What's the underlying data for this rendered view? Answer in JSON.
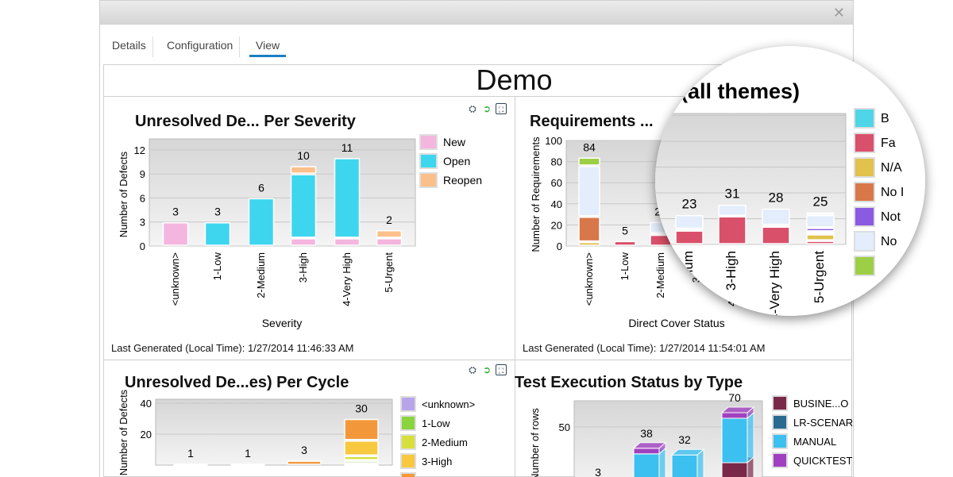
{
  "window": {
    "close_icon": "close-icon",
    "tabs": [
      "Details",
      "Configuration",
      "View"
    ],
    "active_tab": "View"
  },
  "dashboard_title": "Demo",
  "panel_icons": [
    "settings-icon",
    "refresh-icon",
    "maximize-icon"
  ],
  "chart_data": [
    {
      "type": "bar",
      "stacked": true,
      "title": "Unresolved De... Per Severity",
      "xlabel": "Severity",
      "ylabel": "Number of Defects",
      "categories": [
        "<unknown>",
        "1-Low",
        "2-Medium",
        "3-High",
        "4-Very High",
        "5-Urgent"
      ],
      "series": [
        {
          "name": "New",
          "color": "#f4b6df",
          "values": [
            3,
            0,
            0,
            1,
            1,
            1
          ]
        },
        {
          "name": "Open",
          "color": "#3ed6ef",
          "values": [
            0,
            3,
            6,
            8,
            10,
            0
          ]
        },
        {
          "name": "Reopen",
          "color": "#fbc08a",
          "values": [
            0,
            0,
            0,
            1,
            0,
            1
          ]
        }
      ],
      "totals": [
        "3",
        "3",
        "6",
        "10",
        "11",
        "2"
      ],
      "yticks": [
        "0",
        "3",
        "6",
        "9",
        "12"
      ],
      "ylim": [
        0,
        13.4
      ],
      "grid": true,
      "legend": "right",
      "footer": "Last Generated (Local Time):  1/27/2014 11:46:33 AM"
    },
    {
      "type": "bar",
      "stacked": true,
      "title": "Requirements ...",
      "magnified_title": ". (all themes)",
      "xlabel": "Direct Cover Status",
      "ylabel": "Number of Requirements",
      "categories": [
        "<unknown>",
        "1-Low",
        "2-Medium",
        "3-High",
        "4-Very High",
        "5-Urgent"
      ],
      "series": [
        {
          "name": "B",
          "color": "#4fd5e8",
          "values": [
            0,
            0,
            0,
            0,
            0,
            0
          ]
        },
        {
          "name": "Fa",
          "color": "#d9506b",
          "values": [
            0,
            5,
            11,
            22,
            14,
            3
          ]
        },
        {
          "name": "N/A",
          "color": "#e0c24c",
          "values": [
            4,
            0,
            0,
            0,
            0,
            5
          ]
        },
        {
          "name": "No I",
          "color": "#d8784a",
          "values": [
            24,
            0,
            1,
            0,
            1,
            2
          ]
        },
        {
          "name": "Not",
          "color": "#8a5ae0",
          "values": [
            0,
            0,
            0,
            0,
            0,
            3
          ]
        },
        {
          "name": "No",
          "color": "#e3edfb",
          "values": [
            48,
            0,
            11,
            9,
            13,
            10
          ]
        },
        {
          "name": "",
          "color": "#9ccf45",
          "values": [
            8,
            0,
            0,
            0,
            0,
            2
          ]
        }
      ],
      "totals": [
        "84",
        "5",
        "23",
        "31",
        "28",
        "25"
      ],
      "yticks": [
        "0",
        "20",
        "40",
        "60",
        "80",
        "100"
      ],
      "ylim": [
        0,
        100
      ],
      "grid": true,
      "legend": "right",
      "footer": "Last Generated (Local Time):  1/27/2014 11:54:01 AM"
    },
    {
      "type": "bar",
      "stacked": true,
      "title": "Unresolved De...es) Per Cycle",
      "ylabel": "Number of Defects",
      "series": [
        {
          "name": "<unknown>",
          "color": "#b8a4ea",
          "values": [
            0,
            0,
            0,
            1
          ]
        },
        {
          "name": "1-Low",
          "color": "#8ad43c",
          "values": [
            0,
            0,
            0,
            2
          ]
        },
        {
          "name": "2-Medium",
          "color": "#d6e03a",
          "values": [
            0,
            0,
            0,
            3
          ]
        },
        {
          "name": "3-High",
          "color": "#f8c83e",
          "values": [
            0,
            0,
            0,
            10
          ]
        },
        {
          "name": "",
          "color": "#f3983a",
          "values": [
            1,
            1,
            3,
            14
          ]
        }
      ],
      "totals": [
        "1",
        "1",
        "3",
        "30"
      ],
      "yticks": [
        "20",
        "40"
      ],
      "ylim": [
        0,
        40
      ],
      "grid": true,
      "legend": "right"
    },
    {
      "type": "bar",
      "stacked": true,
      "style": "3d",
      "title": "Test Execution Status by Type",
      "ylabel": "Number of rows",
      "series": [
        {
          "name": "BUSINE...O",
          "color": "#7a2848",
          "values": [
            0,
            0,
            0,
            25
          ]
        },
        {
          "name": "LR-SCENAR",
          "color": "#2a6a90",
          "values": [
            0,
            0,
            0,
            0
          ]
        },
        {
          "name": "MANUAL",
          "color": "#3cc0f0",
          "values": [
            3,
            33,
            32,
            40
          ]
        },
        {
          "name": "QUICKTEST",
          "color": "#a040c0",
          "values": [
            0,
            5,
            0,
            5
          ]
        }
      ],
      "totals": [
        "3",
        "38",
        "32",
        "70"
      ],
      "yticks": [
        "50"
      ],
      "grid": true,
      "legend": "right"
    }
  ]
}
